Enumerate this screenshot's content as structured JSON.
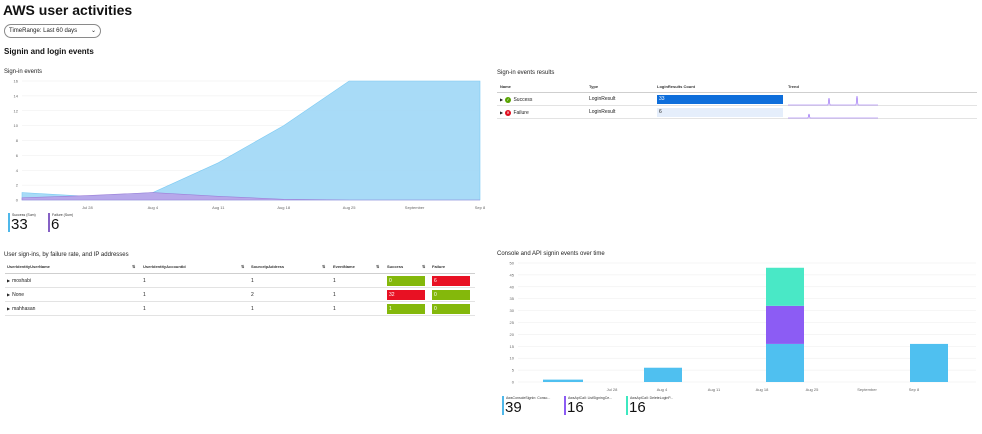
{
  "page": {
    "title": "AWS user activities",
    "time_range": "TimeRange: Last 60 days",
    "section": "Signin and login events"
  },
  "signin_events": {
    "title": "Sign-in events",
    "tiles": [
      {
        "label": "Success (Sum)",
        "value": "33",
        "color": "#4fb8ea"
      },
      {
        "label": "Failure (Sum)",
        "value": "6",
        "color": "#8661c5"
      }
    ]
  },
  "results": {
    "title": "Sign-in events results",
    "columns": [
      "Name",
      "Type",
      "LoginResults Count",
      "Trend"
    ],
    "rows": [
      {
        "name": "Success",
        "type": "LoginResult",
        "count": "33",
        "icon": "success-icon",
        "bar_fraction": 1.0,
        "bar_color": "#0e6edb"
      },
      {
        "name": "Failure",
        "type": "LoginResult",
        "count": "6",
        "icon": "failure-icon",
        "bar_fraction": 1.0,
        "bar_color": "#e5eefb"
      }
    ]
  },
  "users": {
    "title": "User sign-ins, by failure rate, and IP addresses",
    "columns": [
      "UserIdentityUserName",
      "UserIdentityAccountId",
      "SourceIpAddress",
      "EventName",
      "Success",
      "Failure"
    ],
    "rows": [
      {
        "name": "moshabi",
        "account": "1",
        "ip": "1",
        "event": "1",
        "success": "0",
        "failure": "6",
        "success_color": "#84b80b",
        "failure_color": "#e81123"
      },
      {
        "name": "None",
        "account": "1",
        "ip": "2",
        "event": "1",
        "success": "32",
        "failure": "0",
        "success_color": "#e81123",
        "failure_color": "#84b80b"
      },
      {
        "name": "mahhasan",
        "account": "1",
        "ip": "1",
        "event": "1",
        "success": "1",
        "failure": "0",
        "success_color": "#84b80b",
        "failure_color": "#84b80b"
      }
    ]
  },
  "console": {
    "title": "Console and API signin events over time",
    "tiles": [
      {
        "label": "AwsConsoleSignIn: Conso...",
        "value": "39",
        "color": "#4fb8ea"
      },
      {
        "label": "AwsApiCall: ListSigningCe...",
        "value": "16",
        "color": "#8c5cf4"
      },
      {
        "label": "AwsApiCall: DeleteLoginP...",
        "value": "16",
        "color": "#3ee8c0"
      }
    ]
  },
  "chart_data": [
    {
      "type": "area",
      "title": "Sign-in events",
      "x": [
        "Jul 21",
        "Jul 28",
        "Aug 4",
        "Aug 11",
        "Aug 18",
        "Aug 25",
        "September",
        "Sep 8"
      ],
      "x_tick_labels": [
        "Jul 28",
        "Aug 4",
        "Aug 11",
        "Aug 18",
        "Aug 25",
        "September",
        "Sep 8"
      ],
      "ylim": [
        0,
        16
      ],
      "y_ticks": [
        0,
        2,
        4,
        6,
        8,
        10,
        12,
        14,
        16
      ],
      "series": [
        {
          "name": "Success (Sum)",
          "color": "#a3d9f7",
          "values": [
            1,
            0.5,
            1,
            5,
            10,
            16,
            16,
            16
          ]
        },
        {
          "name": "Failure (Sum)",
          "color": "#b8a2e8",
          "values": [
            0.3,
            0.6,
            1,
            0.5,
            0.1,
            0,
            0,
            0
          ]
        }
      ],
      "grid": true,
      "legend": "bottom-left"
    },
    {
      "type": "bar",
      "title": "Console and API signin events over time",
      "stacked": true,
      "x_tick_labels": [
        "Jul 28",
        "Aug 4",
        "Aug 11",
        "Aug 18",
        "Aug 25",
        "September",
        "Sep 8"
      ],
      "ylim": [
        0,
        50
      ],
      "y_ticks": [
        0,
        5,
        10,
        15,
        20,
        25,
        30,
        35,
        40,
        45,
        50
      ],
      "bars": [
        {
          "x": "Jul 24",
          "segments": [
            1,
            0,
            0
          ]
        },
        {
          "x": "Aug 3",
          "segments": [
            6,
            0,
            0
          ]
        },
        {
          "x": "Aug 22",
          "segments": [
            16,
            16,
            16
          ]
        },
        {
          "x": "Sep 9",
          "segments": [
            16,
            0,
            0
          ]
        }
      ],
      "series": [
        {
          "name": "AwsConsoleSignIn: Conso...",
          "color": "#4fc0f0"
        },
        {
          "name": "AwsApiCall: ListSigningCe...",
          "color": "#8c5cf4"
        },
        {
          "name": "AwsApiCall: DeleteLoginP...",
          "color": "#49e8c6"
        }
      ],
      "grid": true,
      "legend": "bottom-left"
    }
  ]
}
